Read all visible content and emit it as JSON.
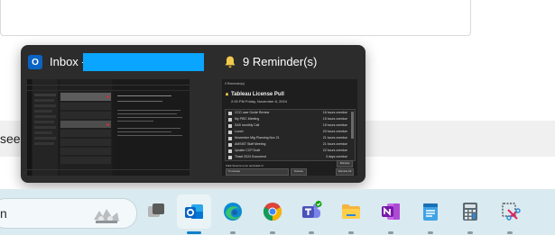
{
  "background": {
    "partial_text": "see"
  },
  "popup": {
    "title": "Inbox - ",
    "reminders_label": "9 Reminder(s)",
    "app_icon": "outlook-icon",
    "bell_icon": "bell-icon",
    "redaction_color": "#0aa5ff",
    "reminder_window": {
      "header": "9 Reminder(s)",
      "title": "Tableau License Pull",
      "subtitle": "2:00 PM Friday, November 8, 2024",
      "items": [
        {
          "name": "CCO user Guide Review",
          "overdue": "16 hours overdue"
        },
        {
          "name": "My PIEC Meeting",
          "overdue": "15 hours overdue"
        },
        {
          "name": "SAS monthly Call",
          "overdue": "16 hours overdue"
        },
        {
          "name": "Lunch",
          "overdue": "20 hours overdue"
        },
        {
          "name": "November Mtg Planning Nov 21",
          "overdue": "21 hours overdue"
        },
        {
          "name": "AMSIST Staff Meeting",
          "overdue": "21 hours overdue"
        },
        {
          "name": "Update CCP Draft",
          "overdue": "22 hours overdue"
        },
        {
          "name": "Tinsel 2024 Document",
          "overdue": "3 days overdue"
        }
      ],
      "dismiss_label": "Dismiss",
      "footer_label": "Click Snooze to be reminded in:",
      "snooze_value": "5 minutes",
      "snooze_label": "Snooze",
      "dismiss_all_label": "Dismiss All"
    }
  },
  "taskbar": {
    "search_partial": "n",
    "apps": [
      {
        "name": "task-view",
        "active": false
      },
      {
        "name": "outlook",
        "active": true
      },
      {
        "name": "edge",
        "active": false
      },
      {
        "name": "chrome",
        "active": false
      },
      {
        "name": "teams",
        "active": false
      },
      {
        "name": "file-explorer",
        "active": false
      },
      {
        "name": "onenote",
        "active": false
      },
      {
        "name": "notepad",
        "active": false
      },
      {
        "name": "calculator",
        "active": false
      },
      {
        "name": "snipping-tool",
        "active": false
      }
    ],
    "accent_color": "#0a80c9"
  }
}
